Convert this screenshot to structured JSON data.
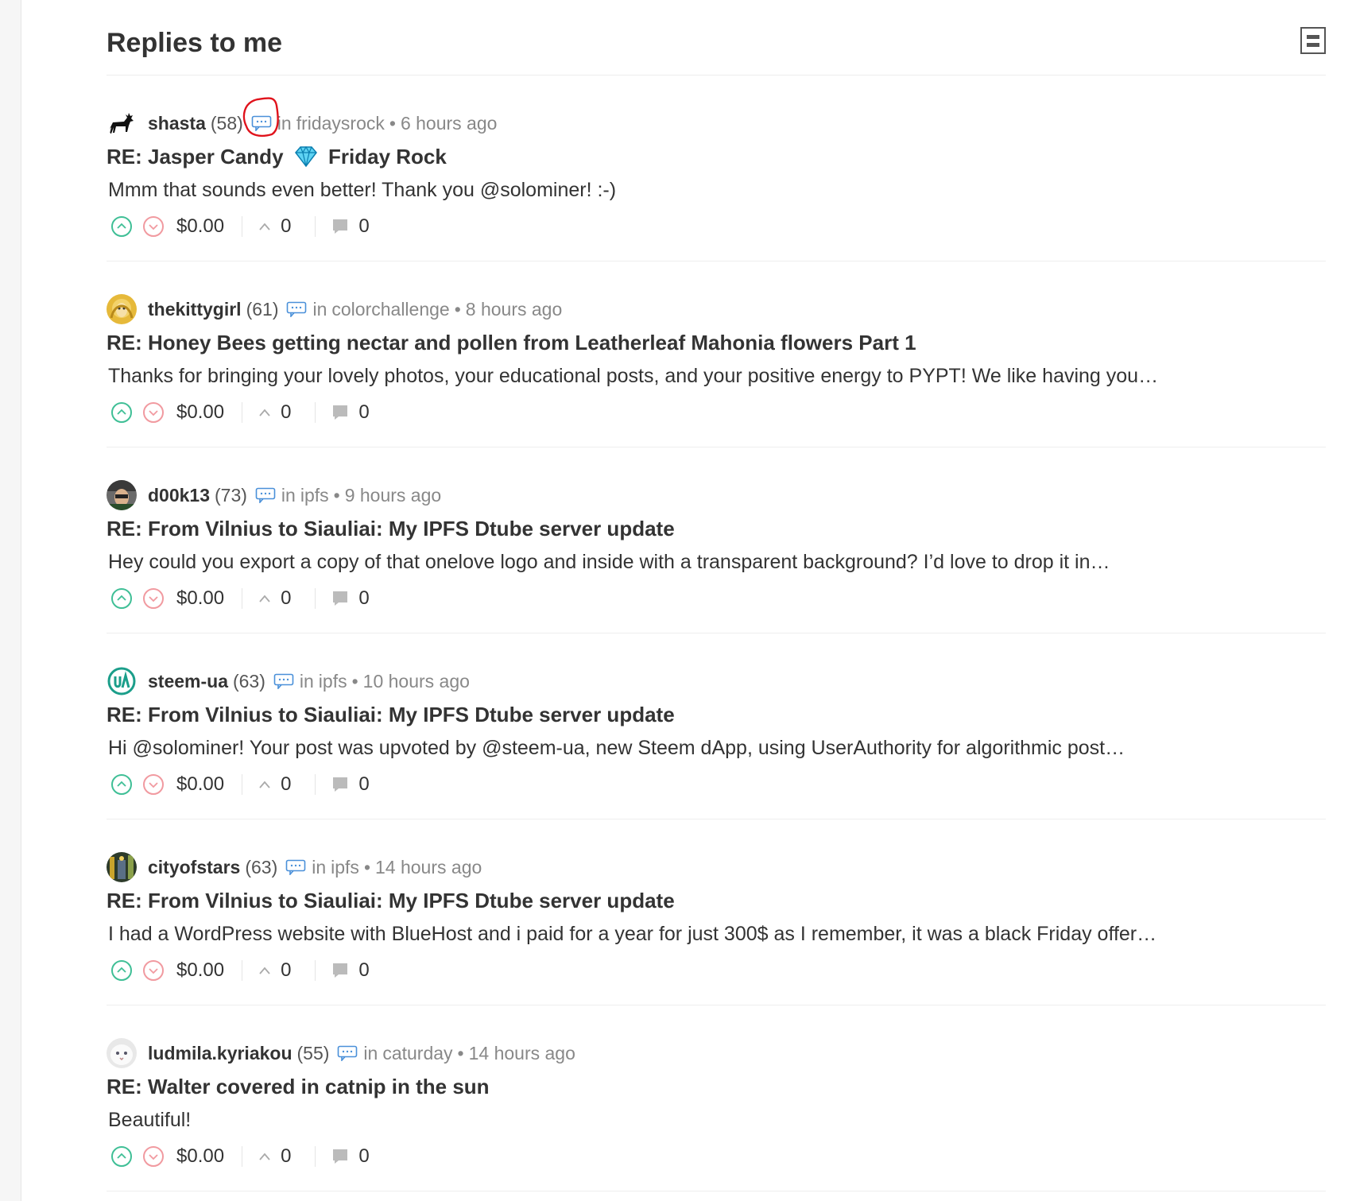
{
  "header": {
    "title": "Replies to me"
  },
  "replies": [
    {
      "author": "shasta",
      "reputation": "(58)",
      "in_word": "in",
      "community": "fridaysrock",
      "time": "6 hours ago",
      "title_part1": "RE: Jasper Candy",
      "title_part2": "Friday Rock",
      "body": "Mmm that sounds even better! Thank you @solominer! :-)",
      "payout": "$0.00",
      "votes": "0",
      "children": "0"
    },
    {
      "author": "thekittygirl",
      "reputation": "(61)",
      "in_word": "in",
      "community": "colorchallenge",
      "time": "8 hours ago",
      "title": "RE: Honey Bees getting nectar and pollen from Leatherleaf Mahonia flowers Part 1",
      "body": "Thanks for bringing your lovely photos, your educational posts, and your positive energy to PYPT! We like having you…",
      "payout": "$0.00",
      "votes": "0",
      "children": "0"
    },
    {
      "author": "d00k13",
      "reputation": "(73)",
      "in_word": "in",
      "community": "ipfs",
      "time": "9 hours ago",
      "title": "RE: From Vilnius to Siauliai: My IPFS Dtube server update",
      "body": "Hey could you export a copy of that onelove logo and inside with a transparent background? I’d love to drop it in…",
      "payout": "$0.00",
      "votes": "0",
      "children": "0"
    },
    {
      "author": "steem-ua",
      "reputation": "(63)",
      "in_word": "in",
      "community": "ipfs",
      "time": "10 hours ago",
      "title": "RE: From Vilnius to Siauliai: My IPFS Dtube server update",
      "body": "Hi @solominer! Your post was upvoted by @steem-ua, new Steem dApp, using UserAuthority for algorithmic post…",
      "payout": "$0.00",
      "votes": "0",
      "children": "0"
    },
    {
      "author": "cityofstars",
      "reputation": "(63)",
      "in_word": "in",
      "community": "ipfs",
      "time": "14 hours ago",
      "title": "RE: From Vilnius to Siauliai: My IPFS Dtube server update",
      "body": "I had a WordPress website with BlueHost and i paid for a year for just 300$ as I remember, it was a black Friday offer…",
      "payout": "$0.00",
      "votes": "0",
      "children": "0"
    },
    {
      "author": "ludmila.kyriakou",
      "reputation": "(55)",
      "in_word": "in",
      "community": "caturday",
      "time": "14 hours ago",
      "title": "RE: Walter covered in catnip in the sun",
      "body": "Beautiful!",
      "payout": "$0.00",
      "votes": "0",
      "children": "0"
    }
  ],
  "meta_separator": "•",
  "colors": {
    "upvote": "#3fbf96",
    "downvote": "#f19aa0",
    "comment_icon": "#4a90d9",
    "annotation": "#e0121b"
  },
  "icons": {
    "upvote": "chevron-up-circle-icon",
    "downvote": "chevron-down-circle-icon",
    "votes": "caret-up-icon",
    "children": "speech-bubble-icon",
    "comment": "comment-icon",
    "layout": "layout-toggle-icon"
  }
}
